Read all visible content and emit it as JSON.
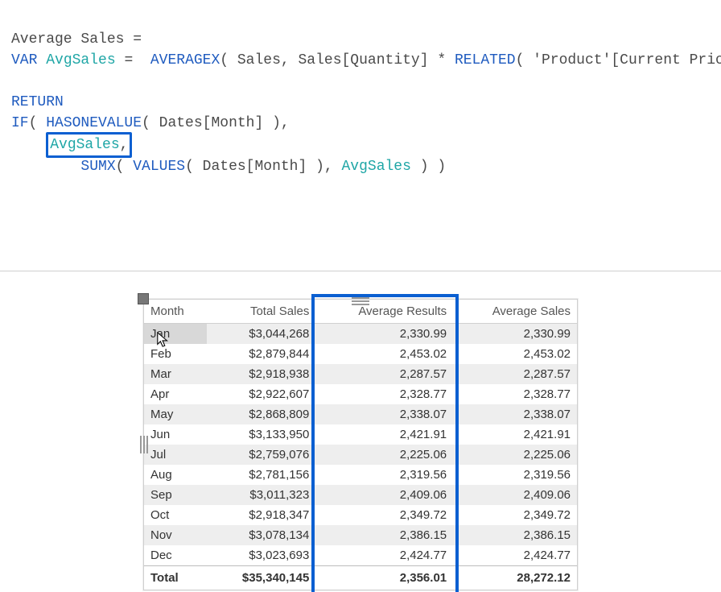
{
  "code": {
    "line1": {
      "a": "Average Sales = "
    },
    "line2": {
      "a": "VAR ",
      "b": "AvgSales",
      "c": " =  ",
      "d": "AVERAGEX",
      "e": "( Sales, Sales[Quantity] * ",
      "f": "RELATED",
      "g": "( 'Product'[Current Price] ) )"
    },
    "line3": {
      "a": "RETURN"
    },
    "line4": {
      "a": "IF",
      "b": "( ",
      "c": "HASONEVALUE",
      "d": "( Dates[Month] ),"
    },
    "line5": {
      "a": "    ",
      "b": "AvgSales",
      "c": ","
    },
    "line6": {
      "a": "        ",
      "b": "SUMX",
      "c": "( ",
      "d": "VALUES",
      "e": "( Dates[Month] ), ",
      "f": "AvgSales",
      "g": " ) )"
    }
  },
  "table": {
    "headers": {
      "month": "Month",
      "total": "Total Sales",
      "avgres": "Average Results",
      "avgsales": "Average Sales"
    },
    "rows": [
      {
        "month": "Jan",
        "total": "$3,044,268",
        "avgres": "2,330.99",
        "avgsales": "2,330.99"
      },
      {
        "month": "Feb",
        "total": "$2,879,844",
        "avgres": "2,453.02",
        "avgsales": "2,453.02"
      },
      {
        "month": "Mar",
        "total": "$2,918,938",
        "avgres": "2,287.57",
        "avgsales": "2,287.57"
      },
      {
        "month": "Apr",
        "total": "$2,922,607",
        "avgres": "2,328.77",
        "avgsales": "2,328.77"
      },
      {
        "month": "May",
        "total": "$2,868,809",
        "avgres": "2,338.07",
        "avgsales": "2,338.07"
      },
      {
        "month": "Jun",
        "total": "$3,133,950",
        "avgres": "2,421.91",
        "avgsales": "2,421.91"
      },
      {
        "month": "Jul",
        "total": "$2,759,076",
        "avgres": "2,225.06",
        "avgsales": "2,225.06"
      },
      {
        "month": "Aug",
        "total": "$2,781,156",
        "avgres": "2,319.56",
        "avgsales": "2,319.56"
      },
      {
        "month": "Sep",
        "total": "$3,011,323",
        "avgres": "2,409.06",
        "avgsales": "2,409.06"
      },
      {
        "month": "Oct",
        "total": "$2,918,347",
        "avgres": "2,349.72",
        "avgsales": "2,349.72"
      },
      {
        "month": "Nov",
        "total": "$3,078,134",
        "avgres": "2,386.15",
        "avgsales": "2,386.15"
      },
      {
        "month": "Dec",
        "total": "$3,023,693",
        "avgres": "2,424.77",
        "avgsales": "2,424.77"
      }
    ],
    "total": {
      "label": "Total",
      "total": "$35,340,145",
      "avgres": "2,356.01",
      "avgsales": "28,272.12"
    }
  }
}
